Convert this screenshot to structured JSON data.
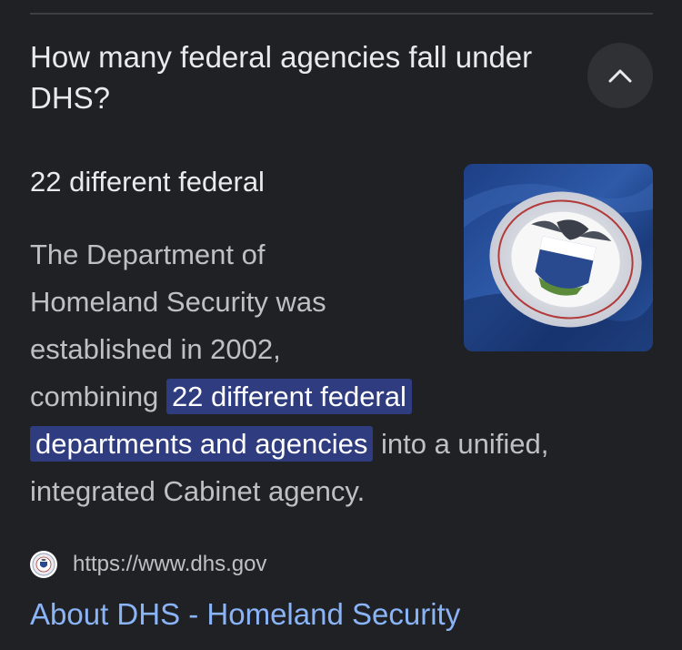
{
  "colors": {
    "background": "#202124",
    "primary_text": "#e8eaed",
    "secondary_text": "#bdc1c6",
    "link": "#8ab4f8",
    "highlight_bg": "#2f3d80",
    "button_bg": "#303134"
  },
  "faq": {
    "question": "How many federal agencies fall under DHS?",
    "collapse_icon": "chevron-up-icon",
    "short_answer": "22 different federal",
    "snippet": {
      "line_1": "The Department of",
      "line_2": "Homeland Security was",
      "line_3": "established in 2002,",
      "before_highlight": "combining",
      "highlight_part_1": "22 different federal",
      "highlight_part_2": "departments and agencies",
      "after_highlight": "into a unified,",
      "line_last": "integrated Cabinet agency."
    },
    "image": "dhs-seal-flag-image"
  },
  "source": {
    "favicon": "dhs-seal-icon",
    "url": "https://www.dhs.gov",
    "title": "About DHS - Homeland Security"
  }
}
